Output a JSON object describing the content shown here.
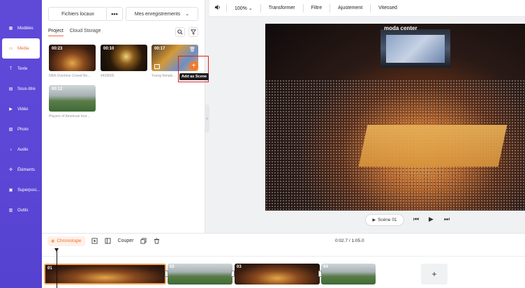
{
  "sidebar": {
    "items": [
      {
        "label": "Modèles",
        "icon": "template-icon"
      },
      {
        "label": "Média",
        "icon": "media-icon"
      },
      {
        "label": "Texte",
        "icon": "text-icon"
      },
      {
        "label": "Sous-titre",
        "icon": "subtitle-icon"
      },
      {
        "label": "Vidéo",
        "icon": "video-icon"
      },
      {
        "label": "Photo",
        "icon": "photo-icon"
      },
      {
        "label": "Audio",
        "icon": "audio-icon"
      },
      {
        "label": "Éléments",
        "icon": "elements-icon"
      },
      {
        "label": "Superposi...",
        "icon": "overlay-icon"
      },
      {
        "label": "Outils",
        "icon": "tools-icon"
      }
    ],
    "active_index": 1
  },
  "panel": {
    "local_files": "Fichiers locaux",
    "more": "•••",
    "recordings": "Mes enregistrements",
    "tabs": [
      "Project",
      "Cloud Storage"
    ],
    "media": [
      {
        "duration": "00:23",
        "caption": "NBA Overtime Crowd Re..."
      },
      {
        "duration": "00:10",
        "caption": "4439000"
      },
      {
        "duration": "00:17",
        "caption": "Young female..."
      },
      {
        "duration": "00:12",
        "caption": "Players of American foot..."
      }
    ],
    "tooltip": "Add as Scene"
  },
  "toolbar": {
    "zoom": "100%",
    "items": [
      "Transformer",
      "Filtre",
      "Ajustement",
      "Vitessed"
    ]
  },
  "preview": {
    "arena_text": "moda center",
    "scene_label": "Scène 01"
  },
  "timeline": {
    "label": "Chronologie",
    "cut": "Couper",
    "time": "0:02.7 / 1:05.0",
    "clips": [
      "01",
      "02",
      "03",
      "04"
    ],
    "add": "+"
  },
  "colors": {
    "accent": "#f06b2d",
    "sidebar": "#5b46d6",
    "highlight": "#e02020"
  }
}
